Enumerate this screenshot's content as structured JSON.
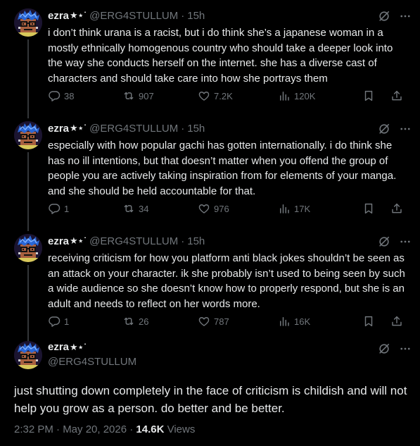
{
  "author": {
    "name": "ezra",
    "badge": "★⋆˙",
    "handle": "@ERG4STULLUM"
  },
  "icons": {
    "reply": "reply-icon",
    "retweet": "retweet-icon",
    "like": "heart-icon",
    "views": "views-chart-icon",
    "bookmark": "bookmark-icon",
    "share": "share-icon",
    "grok": "grok-icon",
    "more": "more-dots-icon"
  },
  "colors": {
    "background": "#000000",
    "text": "#e7e9ea",
    "secondary": "#71767b",
    "thread_line": "#333639"
  },
  "tweets": [
    {
      "time": "15h",
      "text": "i don’t think urana is a racist, but i do think she’s a japanese woman in a mostly ethnically homogenous country who should take a deeper look into the way she conducts herself on the internet. she has a diverse cast of characters and should take care into how she portrays them",
      "replies": "38",
      "retweets": "907",
      "likes": "7.2K",
      "views": "120K"
    },
    {
      "time": "15h",
      "text": "especially with how popular gachi has gotten internationally. i do think she has no ill intentions, but that doesn’t matter when you offend the group of people you are actively taking inspiration from for elements of your manga. and she should be held accountable for that.",
      "replies": "1",
      "retweets": "34",
      "likes": "976",
      "views": "17K"
    },
    {
      "time": "15h",
      "text": "receiving criticism for how you platform anti black jokes shouldn’t be seen as an attack on your character. ik she probably isn’t used to being seen by such a wide audience so she doesn’t know how to properly respond, but she is an adult and needs to reflect on her words more.",
      "replies": "1",
      "retweets": "26",
      "likes": "787",
      "views": "16K"
    }
  ],
  "main": {
    "text": "just shutting down completely in the face of criticism is childish and will not help you grow as a person. do better and be better.",
    "timestamp": "2:32 PM · May 20, 2026 · ",
    "views_count": "14.6K",
    "views_label": " Views"
  }
}
